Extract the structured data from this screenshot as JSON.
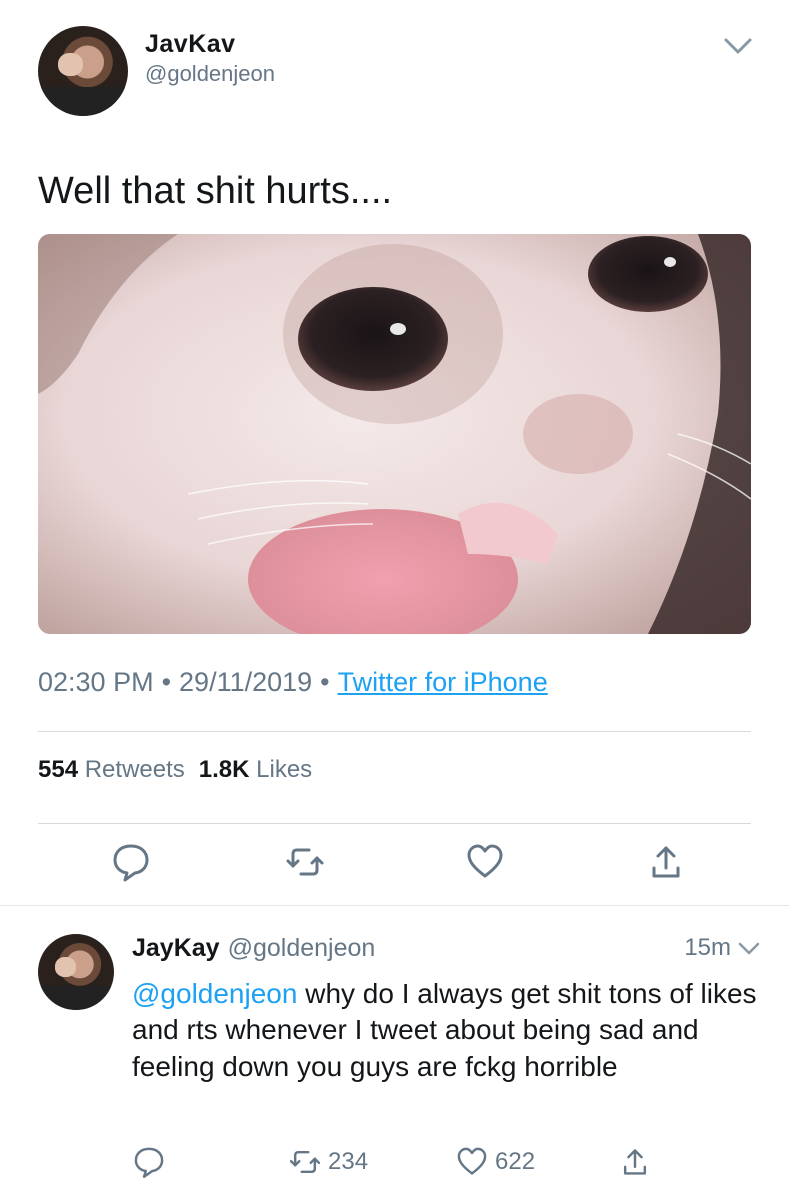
{
  "tweet": {
    "display_name": "JavKav",
    "handle": "@goldenjeon",
    "text": "Well that shit hurts....",
    "time": "02:30 PM",
    "date": "29/11/2019",
    "source": "Twitter for iPhone",
    "retweets_count": "554",
    "retweets_label": "Retweets",
    "likes_count": "1.8K",
    "likes_label": "Likes"
  },
  "reply": {
    "display_name": "JayKay",
    "handle": "@goldenjeon",
    "time": "15m",
    "mention": "@goldenjeon",
    "text": " why do I always get shit tons of likes and rts whenever I tweet about being sad and feeling down you guys are fckg horrible",
    "retweets_count": "234",
    "likes_count": "622"
  },
  "colors": {
    "link": "#1da1f2",
    "secondary_text": "#657786",
    "icon": "#657786"
  }
}
